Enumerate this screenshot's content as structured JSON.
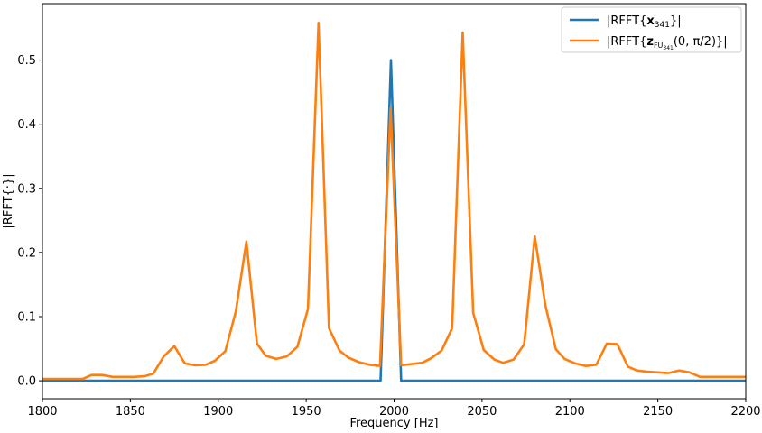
{
  "chart_data": {
    "type": "line",
    "title": "",
    "xlabel": "Frequency [Hz]",
    "ylabel": "|RFFT{·}|",
    "xlim": [
      1800,
      2200
    ],
    "ylim": [
      -0.028,
      0.588
    ],
    "x_ticks": [
      1800,
      1850,
      1900,
      1950,
      2000,
      2050,
      2100,
      2150,
      2200
    ],
    "y_ticks": [
      0.0,
      0.1,
      0.2,
      0.3,
      0.4,
      0.5
    ],
    "x_tick_labels": [
      "1800",
      "1850",
      "1900",
      "1950",
      "2000",
      "2050",
      "2100",
      "2150",
      "2200"
    ],
    "y_tick_labels": [
      "0.0",
      "0.1",
      "0.2",
      "0.3",
      "0.4",
      "0.5"
    ],
    "grid": false,
    "legend_position": "top-right",
    "series": [
      {
        "name": "|RFFT{x341}|",
        "legend_base": "|RFFT{",
        "legend_bold": "x",
        "legend_sub": "341",
        "legend_tail": "}|",
        "color": "#1f77b4",
        "x": [
          1800,
          1992.3,
          1998.2,
          2004.0,
          2200
        ],
        "y": [
          0.0,
          0.0,
          0.5,
          0.0,
          0.0
        ]
      },
      {
        "name": "|RFFT{zFU341(0, π/2)}|",
        "legend_base": "|RFFT{",
        "legend_bold": "z",
        "legend_sub": "FU",
        "legend_subsub": "341",
        "legend_tail": "(0, π/2)}|",
        "color": "#ff7f0e",
        "x": [
          1800,
          1806,
          1812,
          1817,
          1823,
          1828,
          1834,
          1840,
          1846,
          1852,
          1858,
          1863,
          1869,
          1875,
          1881,
          1887,
          1893,
          1898,
          1904,
          1910,
          1916,
          1922,
          1927,
          1933,
          1939,
          1945,
          1951,
          1957,
          1963,
          1969,
          1974,
          1980,
          1986,
          1992,
          1998,
          2004,
          2010,
          2016,
          2021,
          2027,
          2033,
          2039,
          2045,
          2051,
          2057,
          2062,
          2068,
          2074,
          2080,
          2086,
          2092,
          2097,
          2103,
          2109,
          2115,
          2121,
          2127,
          2133,
          2138,
          2144,
          2150,
          2156,
          2162,
          2168,
          2174,
          2179,
          2185,
          2191,
          2197,
          2200
        ],
        "y": [
          0.003,
          0.003,
          0.003,
          0.003,
          0.003,
          0.009,
          0.009,
          0.006,
          0.006,
          0.006,
          0.007,
          0.011,
          0.038,
          0.054,
          0.027,
          0.024,
          0.025,
          0.031,
          0.046,
          0.108,
          0.217,
          0.058,
          0.039,
          0.034,
          0.038,
          0.053,
          0.112,
          0.558,
          0.082,
          0.047,
          0.036,
          0.029,
          0.025,
          0.023,
          0.425,
          0.024,
          0.026,
          0.028,
          0.035,
          0.047,
          0.082,
          0.543,
          0.106,
          0.048,
          0.033,
          0.028,
          0.033,
          0.057,
          0.225,
          0.118,
          0.049,
          0.034,
          0.027,
          0.023,
          0.025,
          0.058,
          0.057,
          0.022,
          0.016,
          0.014,
          0.013,
          0.012,
          0.016,
          0.013,
          0.006,
          0.006,
          0.006,
          0.006,
          0.006,
          0.006
        ]
      }
    ]
  }
}
